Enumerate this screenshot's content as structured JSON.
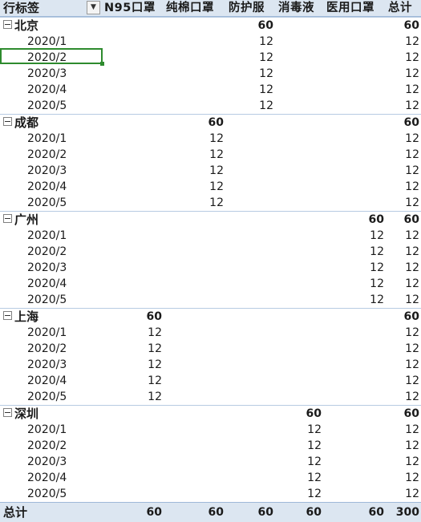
{
  "header": {
    "row_label": "行标签",
    "columns": [
      "N95口罩",
      "纯棉口罩",
      "防护服",
      "消毒液",
      "医用口罩",
      "总计"
    ]
  },
  "groups": [
    {
      "name": "北京",
      "totals": [
        "",
        "",
        "60",
        "",
        "",
        "60"
      ],
      "rows": [
        {
          "date": "2020/1",
          "values": [
            "",
            "",
            "12",
            "",
            "",
            "12"
          ]
        },
        {
          "date": "2020/2",
          "values": [
            "",
            "",
            "12",
            "",
            "",
            "12"
          ]
        },
        {
          "date": "2020/3",
          "values": [
            "",
            "",
            "12",
            "",
            "",
            "12"
          ]
        },
        {
          "date": "2020/4",
          "values": [
            "",
            "",
            "12",
            "",
            "",
            "12"
          ]
        },
        {
          "date": "2020/5",
          "values": [
            "",
            "",
            "12",
            "",
            "",
            "12"
          ]
        }
      ]
    },
    {
      "name": "成都",
      "totals": [
        "",
        "60",
        "",
        "",
        "",
        "60"
      ],
      "rows": [
        {
          "date": "2020/1",
          "values": [
            "",
            "12",
            "",
            "",
            "",
            "12"
          ]
        },
        {
          "date": "2020/2",
          "values": [
            "",
            "12",
            "",
            "",
            "",
            "12"
          ]
        },
        {
          "date": "2020/3",
          "values": [
            "",
            "12",
            "",
            "",
            "",
            "12"
          ]
        },
        {
          "date": "2020/4",
          "values": [
            "",
            "12",
            "",
            "",
            "",
            "12"
          ]
        },
        {
          "date": "2020/5",
          "values": [
            "",
            "12",
            "",
            "",
            "",
            "12"
          ]
        }
      ]
    },
    {
      "name": "广州",
      "totals": [
        "",
        "",
        "",
        "",
        "60",
        "60"
      ],
      "rows": [
        {
          "date": "2020/1",
          "values": [
            "",
            "",
            "",
            "",
            "12",
            "12"
          ]
        },
        {
          "date": "2020/2",
          "values": [
            "",
            "",
            "",
            "",
            "12",
            "12"
          ]
        },
        {
          "date": "2020/3",
          "values": [
            "",
            "",
            "",
            "",
            "12",
            "12"
          ]
        },
        {
          "date": "2020/4",
          "values": [
            "",
            "",
            "",
            "",
            "12",
            "12"
          ]
        },
        {
          "date": "2020/5",
          "values": [
            "",
            "",
            "",
            "",
            "12",
            "12"
          ]
        }
      ]
    },
    {
      "name": "上海",
      "totals": [
        "60",
        "",
        "",
        "",
        "",
        "60"
      ],
      "rows": [
        {
          "date": "2020/1",
          "values": [
            "12",
            "",
            "",
            "",
            "",
            "12"
          ]
        },
        {
          "date": "2020/2",
          "values": [
            "12",
            "",
            "",
            "",
            "",
            "12"
          ]
        },
        {
          "date": "2020/3",
          "values": [
            "12",
            "",
            "",
            "",
            "",
            "12"
          ]
        },
        {
          "date": "2020/4",
          "values": [
            "12",
            "",
            "",
            "",
            "",
            "12"
          ]
        },
        {
          "date": "2020/5",
          "values": [
            "12",
            "",
            "",
            "",
            "",
            "12"
          ]
        }
      ]
    },
    {
      "name": "深圳",
      "totals": [
        "",
        "",
        "",
        "60",
        "",
        "60"
      ],
      "rows": [
        {
          "date": "2020/1",
          "values": [
            "",
            "",
            "",
            "12",
            "",
            "12"
          ]
        },
        {
          "date": "2020/2",
          "values": [
            "",
            "",
            "",
            "12",
            "",
            "12"
          ]
        },
        {
          "date": "2020/3",
          "values": [
            "",
            "",
            "",
            "12",
            "",
            "12"
          ]
        },
        {
          "date": "2020/4",
          "values": [
            "",
            "",
            "",
            "12",
            "",
            "12"
          ]
        },
        {
          "date": "2020/5",
          "values": [
            "",
            "",
            "",
            "12",
            "",
            "12"
          ]
        }
      ]
    }
  ],
  "grand_total": {
    "label": "总计",
    "values": [
      "60",
      "60",
      "60",
      "60",
      "60",
      "300"
    ]
  },
  "colors": {
    "header_bg": "#dce6f1",
    "selection": "#2e8b2e",
    "group_border": "#b7cbe2"
  }
}
